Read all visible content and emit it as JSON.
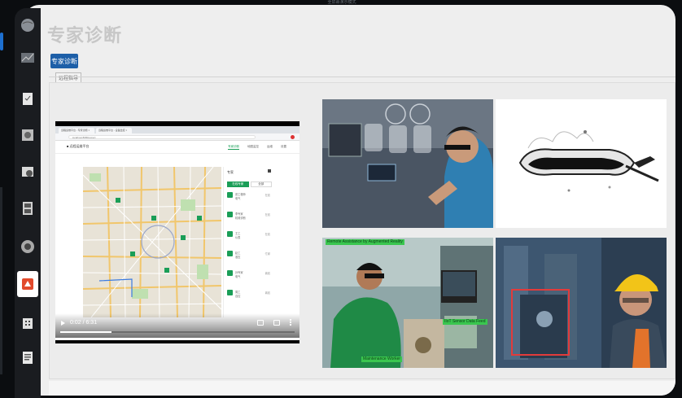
{
  "window": {
    "title": "全屏幕演示模式"
  },
  "page": {
    "title": "专家诊断"
  },
  "tabs": {
    "active_label": "专家诊断",
    "sub_label": "远程指导"
  },
  "video": {
    "browser_tab_1": "远程运维平台 - 专家诊断 ×",
    "browser_tab_2": "远程运维平台 - 设备监控 ×",
    "url": "localhost:8080/expert",
    "app_logo": "■ 远程运维平台",
    "nav": [
      "专家诊断",
      "地图监控",
      "运维",
      "设置"
    ],
    "panel_title": "专家",
    "panel_tabs": [
      "在线专家",
      "全部"
    ],
    "list_items": [
      {
        "name": "张工程师",
        "sub": "电气",
        "value": "在线"
      },
      {
        "name": "李专家",
        "sub": "机械诊断",
        "value": "在线"
      },
      {
        "name": "王工",
        "sub": "仪表",
        "value": "在线"
      },
      {
        "name": "赵工",
        "sub": "液压",
        "value": "忙碌"
      },
      {
        "name": "孙专家",
        "sub": "电气",
        "value": "离线"
      },
      {
        "name": "周工",
        "sub": "自控",
        "value": "离线"
      }
    ],
    "time": "0:02 / 6:31",
    "progress": 0.22
  },
  "photos": {
    "green_banner_top": "Remote Assistance by Augmented Reality",
    "green_banner_mid": "IIoT Sensor Data Feed",
    "green_banner_bottom": "Maintenance Worker"
  },
  "colors": {
    "accent_green": "#1a9e57",
    "tab_blue": "#1d5fa8",
    "overlay_green": "#3ac64f"
  }
}
